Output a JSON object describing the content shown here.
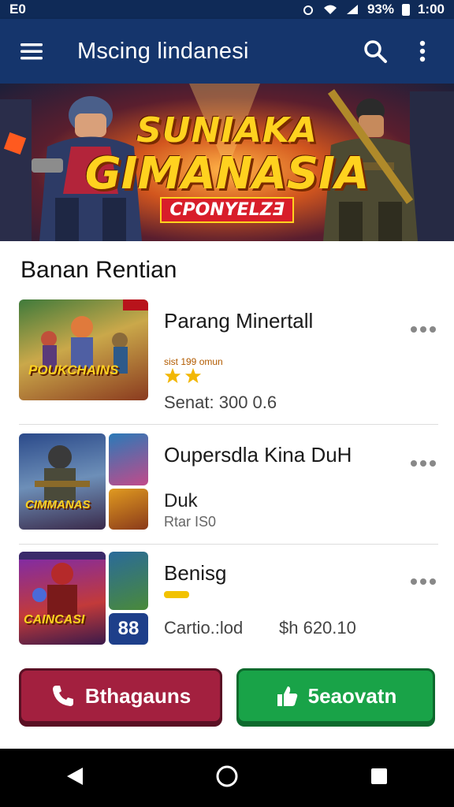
{
  "status_bar": {
    "left_text": "E0",
    "battery": "93%",
    "time": "1:00"
  },
  "app_bar": {
    "title": "Mscing lindanesi",
    "icons": [
      "menu-icon",
      "search-icon",
      "more-vert-icon"
    ]
  },
  "banner": {
    "line1": "SUNIAKA",
    "line2": "GIMANASIA",
    "line3": "CPONYELZƎ"
  },
  "section": {
    "title": "Banan Rentian"
  },
  "items": [
    {
      "title": "Parang Minertall",
      "rating_text": "sist 199 omun",
      "stars": 2,
      "meta": "Senat: 300 0.6",
      "thumb_label": "POUKCHAINS"
    },
    {
      "title": "Oupersdla Kina DuH",
      "sub1": "Duk",
      "sub2": "Rtar IS0",
      "thumb_label": "CIMMANAS"
    },
    {
      "title": "Benisg",
      "meta_left": "Cartio.:lod",
      "meta_right": "$h 620.10",
      "thumb_label": "CAINCASI",
      "badge": "88"
    }
  ],
  "buttons": {
    "left_label": "Bthagauns",
    "right_label": "5eaovatn"
  },
  "colors": {
    "app_bar": "#15356c",
    "status_bar": "#0f2a57",
    "button_red": "#a3203f",
    "button_green": "#19a348",
    "star": "#f2b705"
  }
}
